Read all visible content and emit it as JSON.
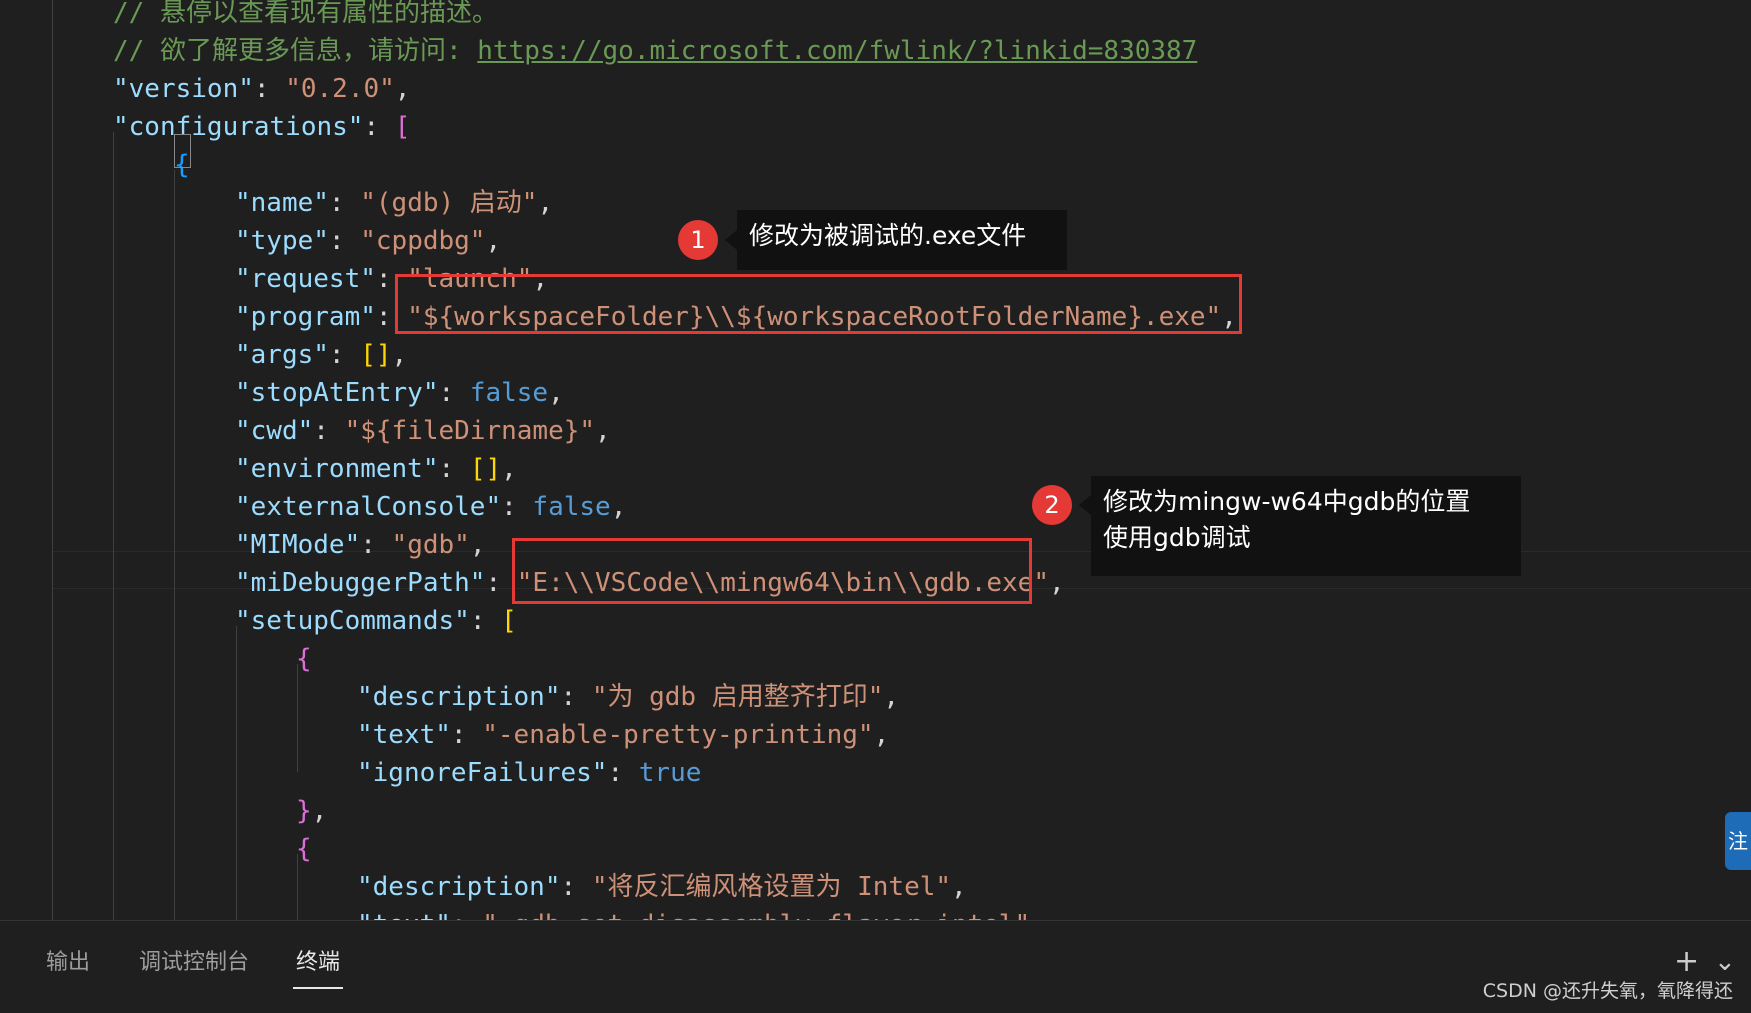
{
  "editor": {
    "lines": [
      {
        "indent": 0,
        "tokens": [
          {
            "t": "comment",
            "v": "// 悬停以查看现有属性的描述。"
          }
        ]
      },
      {
        "indent": 0,
        "tokens": [
          {
            "t": "comment",
            "v": "// 欲了解更多信息，请访问: "
          },
          {
            "t": "link",
            "v": "https://go.microsoft.com/fwlink/?linkid=830387"
          }
        ]
      },
      {
        "indent": 0,
        "tokens": [
          {
            "t": "key",
            "v": "\"version\""
          },
          {
            "t": "punc",
            "v": ": "
          },
          {
            "t": "str",
            "v": "\"0.2.0\""
          },
          {
            "t": "punc",
            "v": ","
          }
        ]
      },
      {
        "indent": 0,
        "tokens": [
          {
            "t": "key",
            "v": "\"configurations\""
          },
          {
            "t": "punc",
            "v": ": "
          },
          {
            "t": "pink",
            "v": "["
          }
        ]
      },
      {
        "indent": 1,
        "tokens": [
          {
            "t": "blue",
            "v": "{"
          }
        ]
      },
      {
        "indent": 2,
        "tokens": [
          {
            "t": "key",
            "v": "\"name\""
          },
          {
            "t": "punc",
            "v": ": "
          },
          {
            "t": "str",
            "v": "\"(gdb) 启动\""
          },
          {
            "t": "punc",
            "v": ","
          }
        ]
      },
      {
        "indent": 2,
        "tokens": [
          {
            "t": "key",
            "v": "\"type\""
          },
          {
            "t": "punc",
            "v": ": "
          },
          {
            "t": "str",
            "v": "\"cppdbg\""
          },
          {
            "t": "punc",
            "v": ","
          }
        ]
      },
      {
        "indent": 2,
        "tokens": [
          {
            "t": "key",
            "v": "\"request\""
          },
          {
            "t": "punc",
            "v": ": "
          },
          {
            "t": "str",
            "v": "\"launch\""
          },
          {
            "t": "punc",
            "v": ","
          }
        ]
      },
      {
        "indent": 2,
        "tokens": [
          {
            "t": "key",
            "v": "\"program\""
          },
          {
            "t": "punc",
            "v": ": "
          },
          {
            "t": "str",
            "v": "\"${workspaceFolder}\\\\${workspaceRootFolderName}.exe\""
          },
          {
            "t": "punc",
            "v": ","
          }
        ]
      },
      {
        "indent": 2,
        "tokens": [
          {
            "t": "key",
            "v": "\"args\""
          },
          {
            "t": "punc",
            "v": ": "
          },
          {
            "t": "yellow",
            "v": "[]"
          },
          {
            "t": "punc",
            "v": ","
          }
        ]
      },
      {
        "indent": 2,
        "tokens": [
          {
            "t": "key",
            "v": "\"stopAtEntry\""
          },
          {
            "t": "punc",
            "v": ": "
          },
          {
            "t": "bool",
            "v": "false"
          },
          {
            "t": "punc",
            "v": ","
          }
        ]
      },
      {
        "indent": 2,
        "tokens": [
          {
            "t": "key",
            "v": "\"cwd\""
          },
          {
            "t": "punc",
            "v": ": "
          },
          {
            "t": "str",
            "v": "\"${fileDirname}\""
          },
          {
            "t": "punc",
            "v": ","
          }
        ]
      },
      {
        "indent": 2,
        "tokens": [
          {
            "t": "key",
            "v": "\"environment\""
          },
          {
            "t": "punc",
            "v": ": "
          },
          {
            "t": "yellow",
            "v": "[]"
          },
          {
            "t": "punc",
            "v": ","
          }
        ]
      },
      {
        "indent": 2,
        "tokens": [
          {
            "t": "key",
            "v": "\"externalConsole\""
          },
          {
            "t": "punc",
            "v": ": "
          },
          {
            "t": "bool",
            "v": "false"
          },
          {
            "t": "punc",
            "v": ","
          }
        ]
      },
      {
        "indent": 2,
        "tokens": [
          {
            "t": "key",
            "v": "\"MIMode\""
          },
          {
            "t": "punc",
            "v": ": "
          },
          {
            "t": "str",
            "v": "\"gdb\""
          },
          {
            "t": "punc",
            "v": ","
          }
        ]
      },
      {
        "indent": 2,
        "tokens": [
          {
            "t": "key",
            "v": "\"miDebuggerPath\""
          },
          {
            "t": "punc",
            "v": ": "
          },
          {
            "t": "str",
            "v": "\"E:\\\\VSCode\\\\mingw64\\bin\\\\gdb.exe\""
          },
          {
            "t": "punc",
            "v": ","
          }
        ]
      },
      {
        "indent": 2,
        "tokens": [
          {
            "t": "key",
            "v": "\"setupCommands\""
          },
          {
            "t": "punc",
            "v": ": "
          },
          {
            "t": "yellow",
            "v": "["
          }
        ]
      },
      {
        "indent": 3,
        "tokens": [
          {
            "t": "pink",
            "v": "{"
          }
        ]
      },
      {
        "indent": 4,
        "tokens": [
          {
            "t": "key",
            "v": "\"description\""
          },
          {
            "t": "punc",
            "v": ": "
          },
          {
            "t": "str",
            "v": "\"为 gdb 启用整齐打印\""
          },
          {
            "t": "punc",
            "v": ","
          }
        ]
      },
      {
        "indent": 4,
        "tokens": [
          {
            "t": "key",
            "v": "\"text\""
          },
          {
            "t": "punc",
            "v": ": "
          },
          {
            "t": "str",
            "v": "\"-enable-pretty-printing\""
          },
          {
            "t": "punc",
            "v": ","
          }
        ]
      },
      {
        "indent": 4,
        "tokens": [
          {
            "t": "key",
            "v": "\"ignoreFailures\""
          },
          {
            "t": "punc",
            "v": ": "
          },
          {
            "t": "bool",
            "v": "true"
          }
        ]
      },
      {
        "indent": 3,
        "tokens": [
          {
            "t": "pink",
            "v": "}"
          },
          {
            "t": "punc",
            "v": ","
          }
        ]
      },
      {
        "indent": 3,
        "tokens": [
          {
            "t": "pink",
            "v": "{"
          }
        ]
      },
      {
        "indent": 4,
        "tokens": [
          {
            "t": "key",
            "v": "\"description\""
          },
          {
            "t": "punc",
            "v": ": "
          },
          {
            "t": "str",
            "v": "\"将反汇编风格设置为 Intel\""
          },
          {
            "t": "punc",
            "v": ","
          }
        ]
      },
      {
        "indent": 4,
        "tokens": [
          {
            "t": "key",
            "v": "\"text\""
          },
          {
            "t": "punc",
            "v": ": "
          },
          {
            "t": "str",
            "v": "\"-gdb-set disassembly-flavor intel\""
          },
          {
            "t": "punc",
            "v": ","
          }
        ]
      }
    ]
  },
  "annotations": [
    {
      "number": "1",
      "text": "修改为被调试的.exe文件"
    },
    {
      "number": "2",
      "text_line1": "修改为mingw-w64中gdb的位置",
      "text_line2": "使用gdb调试"
    }
  ],
  "side_tab": {
    "label": "注"
  },
  "panel": {
    "tabs": [
      {
        "label": "输出",
        "active": false
      },
      {
        "label": "调试控制台",
        "active": false
      },
      {
        "label": "终端",
        "active": true
      }
    ],
    "add_label": "+",
    "chevron_label": "⌄"
  },
  "watermark": "CSDN @还升失氧，氧降得还",
  "colors": {
    "background": "#1f1f1f",
    "comment": "#6a9955",
    "key": "#9cdcfe",
    "string": "#ce9178",
    "boolean": "#569cd6",
    "highlight_box": "#e53935",
    "badge": "#e53935",
    "tooltip_bg": "#111111"
  }
}
